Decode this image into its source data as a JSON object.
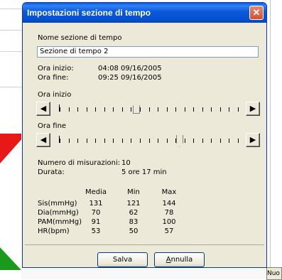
{
  "dialog": {
    "title": "Impostazioni sezione di tempo",
    "close_glyph": "✕"
  },
  "section_name": {
    "label": "Nome sezione di tempo",
    "value": "Sezione di tempo 2"
  },
  "times": {
    "start_label": "Ora inizio:",
    "start_value": "04:08 09/16/2005",
    "end_label": "Ora fine:",
    "end_value": "09:25 09/16/2005"
  },
  "sliders": {
    "start_label": "Ora inizio",
    "end_label": "Ora fine",
    "left_glyph": "◀",
    "right_glyph": "▶",
    "start_position": 0.43,
    "end_position": 0.68
  },
  "summary": {
    "count_label": "Numero di misurazioni:",
    "count_value": "10",
    "duration_label": "Durata:",
    "duration_value": "5 ore 17 min"
  },
  "stats": {
    "headers": [
      "Media",
      "Min",
      "Max"
    ],
    "rows": [
      {
        "label": "Sis(mmHg)",
        "values": [
          "131",
          "121",
          "144"
        ]
      },
      {
        "label": "Dia(mmHg)",
        "values": [
          "70",
          "62",
          "78"
        ]
      },
      {
        "label": "PAM(mmHg)",
        "values": [
          "91",
          "83",
          "100"
        ]
      },
      {
        "label": "HR(bpm)",
        "values": [
          "53",
          "50",
          "57"
        ]
      }
    ]
  },
  "buttons": {
    "save": "Salva",
    "cancel_first": "A",
    "cancel_rest": "nnulla"
  },
  "background": {
    "right_label": "Nuo"
  }
}
